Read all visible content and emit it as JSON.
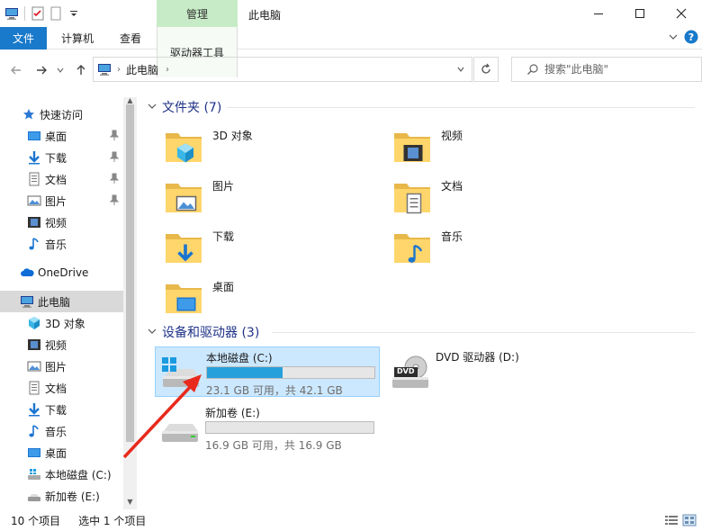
{
  "titlebar": {
    "context_tab": "管理",
    "title": "此电脑"
  },
  "ribbon": {
    "tabs": [
      "文件",
      "计算机",
      "查看",
      "驱动器工具"
    ]
  },
  "address": {
    "path": "此电脑",
    "search_placeholder": "搜索\"此电脑\""
  },
  "sidebar": {
    "quick_access": "快速访问",
    "quick_items": [
      "桌面",
      "下载",
      "文档",
      "图片",
      "视频",
      "音乐"
    ],
    "onedrive": "OneDrive",
    "this_pc": "此电脑",
    "pc_items": [
      "3D 对象",
      "视频",
      "图片",
      "文档",
      "下载",
      "音乐",
      "桌面",
      "本地磁盘 (C:)",
      "新加卷 (E:)"
    ]
  },
  "content": {
    "folders_header": "文件夹 (7)",
    "folders": [
      "3D 对象",
      "视频",
      "图片",
      "文档",
      "下载",
      "音乐",
      "桌面"
    ],
    "drives_header": "设备和驱动器 (3)",
    "drives": [
      {
        "name": "本地磁盘 (C:)",
        "free": "23.1 GB 可用，共 42.1 GB",
        "used_fraction": 0.45
      },
      {
        "name": "DVD 驱动器 (D:)"
      },
      {
        "name": "新加卷 (E:)",
        "free": "16.9 GB 可用，共 16.9 GB",
        "used_fraction": 0.0
      }
    ],
    "dvd_label": "DVD"
  },
  "status": {
    "count": "10 个项目",
    "selected": "选中 1 个项目"
  },
  "colors": {
    "accent": "#1979ca",
    "selection": "#cce8ff",
    "bar_fill": "#26a0da",
    "header_text": "#1e3287",
    "annotation_arrow": "#e8291c"
  }
}
